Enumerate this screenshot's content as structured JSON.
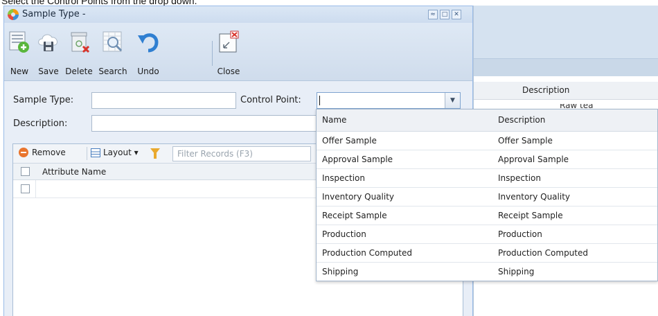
{
  "caption": "Select the Control Points from the drop down.",
  "window": {
    "title": "Sample Type -",
    "controls": {
      "restore": "≈",
      "maximize": "□",
      "close": "✕"
    }
  },
  "toolbar": {
    "new": "New",
    "save": "Save",
    "delete": "Delete",
    "search": "Search",
    "undo": "Undo",
    "close": "Close"
  },
  "form": {
    "sample_type_label": "Sample Type:",
    "sample_type_value": "",
    "control_point_label": "Control Point:",
    "control_point_value": "",
    "description_label": "Description:",
    "description_value": ""
  },
  "grid": {
    "remove": "Remove",
    "layout": "Layout ▾",
    "filter_placeholder": "Filter Records (F3)",
    "column": "Attribute Name"
  },
  "background_window": {
    "column": "Description",
    "cell": "Raw tea Sample"
  },
  "dropdown": {
    "columns": [
      "Name",
      "Description"
    ],
    "rows": [
      [
        "Offer Sample",
        "Offer Sample"
      ],
      [
        "Approval Sample",
        "Approval Sample"
      ],
      [
        "Inspection",
        "Inspection"
      ],
      [
        "Inventory Quality",
        "Inventory Quality"
      ],
      [
        "Receipt Sample",
        "Receipt Sample"
      ],
      [
        "Production",
        "Production"
      ],
      [
        "Production Computed",
        "Production Computed"
      ],
      [
        "Shipping",
        "Shipping"
      ]
    ]
  },
  "colors": {
    "window_bg": "#d0dff0",
    "form_bg": "#e8eef7",
    "accent_border": "#99bbe8"
  },
  "icons": [
    "app-logo-icon",
    "new-record-icon",
    "save-cloud-icon",
    "delete-icon",
    "search-grid-icon",
    "undo-icon",
    "close-window-icon",
    "remove-icon",
    "layout-icon",
    "filter-icon",
    "dropdown-chevron-icon"
  ]
}
